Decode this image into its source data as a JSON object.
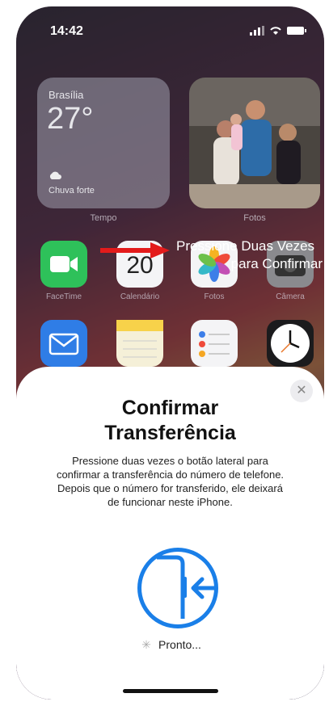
{
  "status_bar": {
    "time": "14:42"
  },
  "widgets": {
    "weather": {
      "city": "Brasília",
      "temperature": "27°",
      "condition": "Chuva forte",
      "label": "Tempo"
    },
    "photos": {
      "label": "Fotos"
    }
  },
  "apps": [
    {
      "name": "FaceTime",
      "color": "#2ec15a"
    },
    {
      "name": "Calendário",
      "day": "20",
      "color": "#ffffff"
    },
    {
      "name": "Fotos",
      "color": "#ffffff"
    },
    {
      "name": "Câmera",
      "color": "#8a8a8e"
    }
  ],
  "overlay_hint": {
    "line1": "Pressione Duas Vezes",
    "line2": "para Confirmar"
  },
  "sheet": {
    "title_line1": "Confirmar",
    "title_line2": "Transferência",
    "body": "Pressione duas vezes o botão lateral para confirmar a transferência do número de telefone. Depois que o número for transferido, ele deixará de funcionar neste iPhone.",
    "status": "Pronto..."
  },
  "colors": {
    "accent": "#1a7fe8",
    "arrow": "#e31b1b"
  }
}
